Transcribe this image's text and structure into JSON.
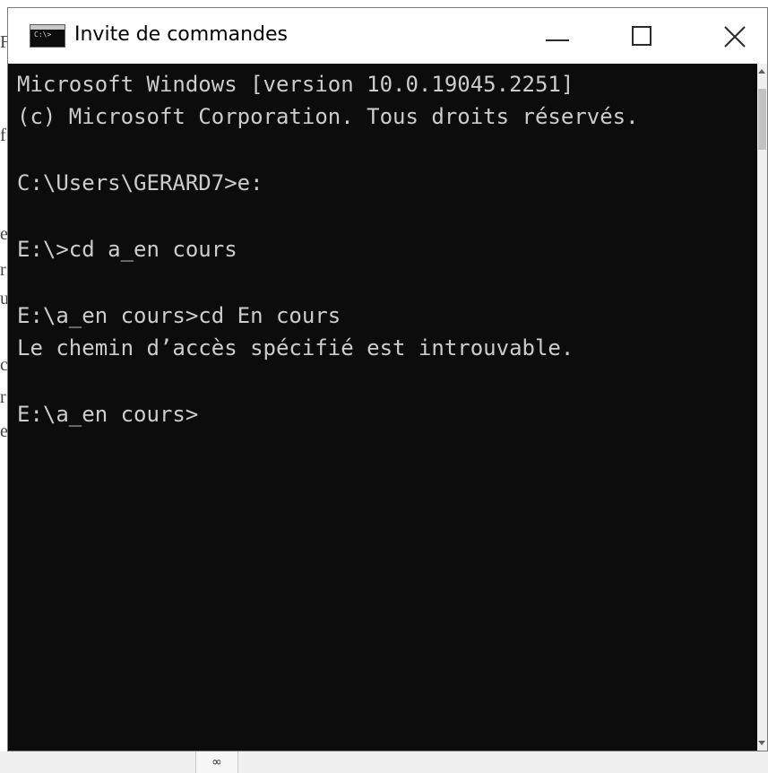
{
  "window": {
    "title": "Invite de commandes",
    "icon": "cmd-app-icon",
    "icon_prompt": "C:\\>"
  },
  "console": {
    "lines": [
      "Microsoft Windows [version 10.0.19045.2251]",
      "(c) Microsoft Corporation. Tous droits réservés.",
      "",
      "C:\\Users\\GERARD7>e:",
      "",
      "E:\\>cd a_en cours",
      "",
      "E:\\a_en cours>cd En cours",
      "Le chemin d’accès spécifié est introuvable.",
      "",
      "E:\\a_en cours>"
    ]
  },
  "background": {
    "side_chars": [
      "F",
      "f",
      "e",
      "r",
      "u",
      "c",
      "r",
      "e"
    ],
    "bottom_segment": "∞"
  },
  "colors": {
    "console_bg": "#0c0c0c",
    "console_text": "#cccccc",
    "titlebar_bg": "#ffffff"
  }
}
